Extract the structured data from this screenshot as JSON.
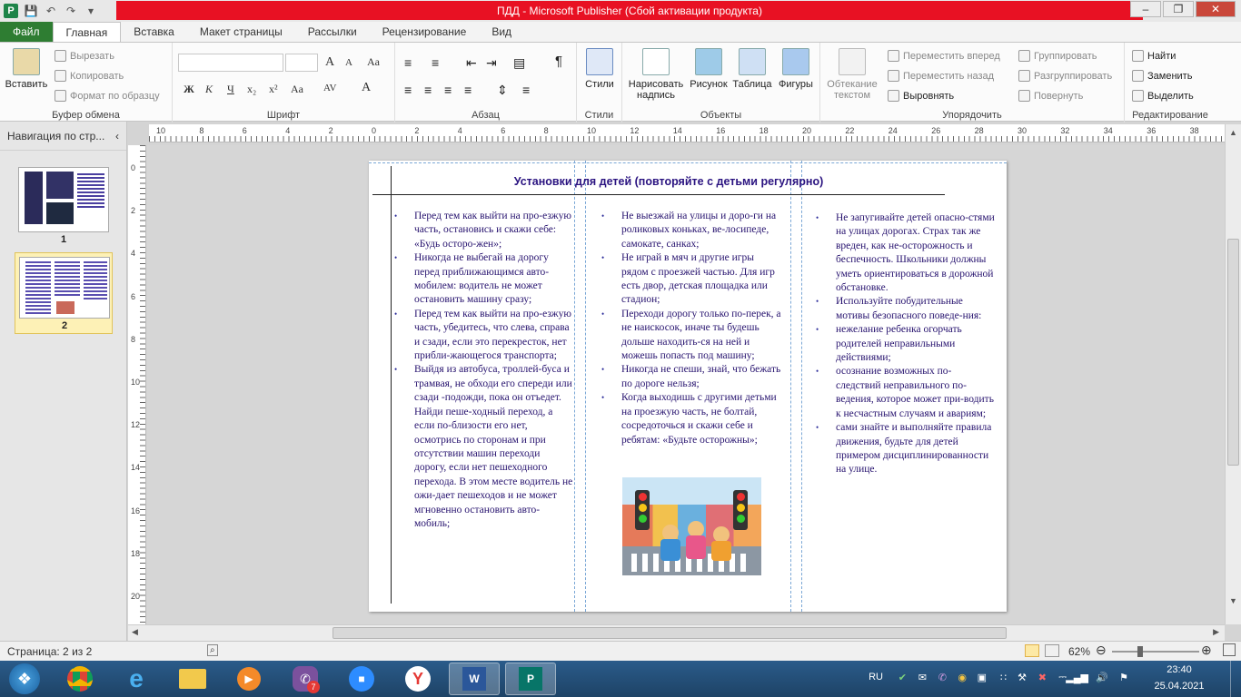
{
  "window": {
    "title": "ПДД  -  Microsoft Publisher (Сбой активации продукта)"
  },
  "ribbon_tabs": [
    "Файл",
    "Главная",
    "Вставка",
    "Макет страницы",
    "Рассылки",
    "Рецензирование",
    "Вид"
  ],
  "ribbon": {
    "clipboard": {
      "paste": "Вставить",
      "cut": "Вырезать",
      "copy": "Копировать",
      "format_painter": "Формат по образцу",
      "label": "Буфер обмена"
    },
    "font": {
      "label": "Шрифт",
      "bold": "Ж",
      "italic": "К",
      "underline": "Ч",
      "subscript": "x₂",
      "superscript": "x²",
      "case": "Aa",
      "spacing": "AV",
      "color": "A",
      "grow": "A",
      "shrink": "A"
    },
    "paragraph": {
      "label": "Абзац",
      "pilcrow": "¶"
    },
    "styles": {
      "label": "Стили",
      "button": "Стили"
    },
    "objects": {
      "label": "Объекты",
      "textbox": "Нарисовать надпись",
      "picture": "Рисунок",
      "table": "Таблица",
      "shapes": "Фигуры"
    },
    "arrange": {
      "label": "Упорядочить",
      "wrap": "Обтекание текстом",
      "forward": "Переместить вперед",
      "backward": "Переместить назад",
      "align": "Выровнять",
      "group": "Группировать",
      "ungroup": "Разгруппировать",
      "rotate": "Повернуть"
    },
    "editing": {
      "label": "Редактирование",
      "find": "Найти",
      "replace": "Заменить",
      "select": "Выделить"
    }
  },
  "nav": {
    "title": "Навигация по стр...",
    "pages": [
      {
        "number": "1"
      },
      {
        "number": "2"
      }
    ]
  },
  "ruler": {
    "h_ticks": [
      "10",
      "8",
      "6",
      "4",
      "2",
      "0",
      "2",
      "4",
      "6",
      "8",
      "10",
      "12",
      "14",
      "16",
      "18",
      "20",
      "22",
      "24",
      "26",
      "28",
      "30",
      "32",
      "34",
      "36",
      "38"
    ],
    "v_ticks": [
      "0",
      "2",
      "4",
      "6",
      "8",
      "10",
      "12",
      "14",
      "16",
      "18",
      "20"
    ]
  },
  "document": {
    "heading": "Установки для детей (повторяйте с детьми регулярно)",
    "col1": [
      "Перед тем как выйти на про-езжую часть, остановись и скажи себе: «Будь осторо-жен»;",
      "Никогда не выбегай на дорогу перед приближающимся авто-мобилем: водитель не может остановить машину сразу;",
      "Перед тем как выйти на про-езжую часть, убедитесь, что слева, справа и сзади, если это перекресток, нет прибли-жающегося транспорта;",
      "Выйдя из автобуса, троллей-буса и трамвая, не обходи его спереди или сзади -подожди, пока он отъедет. Найди пеше-ходный переход, а если по-близости его нет, осмотрись по сторонам и при отсутствии машин переходи дорогу, если нет пешеходного перехода. В этом месте водитель не ожи-дает пешеходов и не может мгновенно остановить авто-мобиль;"
    ],
    "col2": [
      "Не выезжай на улицы и доро-ги на роликовых коньках, ве-лосипеде,  самокате, санках;",
      "Не играй в мяч и другие игры рядом с проезжей частью. Для игр есть двор, детская площадка или стадион;",
      "Переходи дорогу только по-перек, а не наискосок, иначе ты будешь дольше находить-ся на ней и можешь попасть под машину;",
      "Никогда не спеши, знай, что бежать по дороге нельзя;",
      "Когда выходишь с другими детьми на проезжую часть, не болтай, сосредоточься и скажи себе и ребятам: «Будьте осторожны»;"
    ],
    "col3": [
      "Не запугивайте детей опасно-стями на улицах дорогах. Страх так же вреден, как не-осторожность и беспечность. Школьники должны уметь ориентироваться в дорожной обстановке.",
      "Используйте побудительные мотивы безопасного поведе-ния:",
      "нежелание ребенка огорчать родителей неправильными действиями;",
      "осознание возможных по-следствий неправильного по-ведения, которое может при-водить к несчастным случаям и авариям;",
      "сами знайте и выполняйте правила движения, будьте для детей примером дисциплинированности на улице."
    ]
  },
  "status": {
    "page": "Страница: 2 из 2",
    "zoom": "62%",
    "zoom_level": 0.62
  },
  "taskbar": {
    "lang": "RU",
    "time": "23:40",
    "date": "25.04.2021",
    "viber_badge": "7",
    "apps": [
      "start",
      "chrome",
      "ie",
      "explorer",
      "media",
      "viber",
      "zoom",
      "yandex",
      "word",
      "publisher"
    ]
  },
  "colors": {
    "accent": "#2e7d32",
    "title_red": "#e81123",
    "heading": "#2a1380",
    "text": "#26126e"
  }
}
